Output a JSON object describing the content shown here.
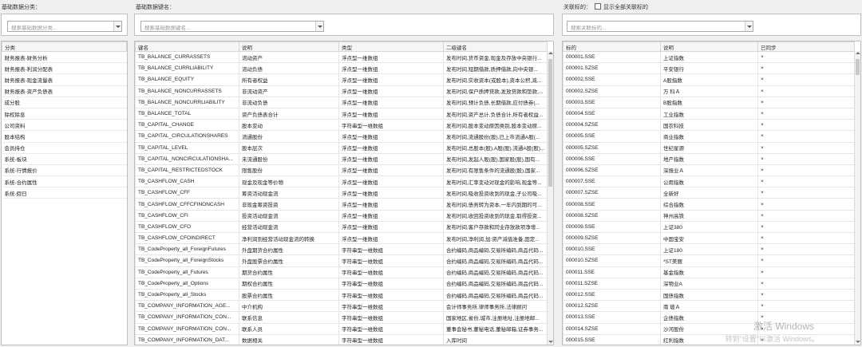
{
  "left_panel": {
    "label": "基础数据分类：",
    "search_placeholder": "搜索基础数据分类...",
    "column_header": "分类",
    "categories": [
      "财务报表-财务分析",
      "财务报表-利润分配表",
      "财务报表-现金流量表",
      "财务报表-资产负债表",
      "成分股",
      "除权除息",
      "公司资料",
      "股本结构",
      "会员持仓",
      "系统-板块",
      "系统-行情报价",
      "系统-合约属性",
      "系统-假日"
    ]
  },
  "middle_panel": {
    "label": "基础数据键名：",
    "search_placeholder": "搜索基础数据键名...",
    "columns": [
      "键名",
      "说明",
      "类型",
      "二级键名"
    ],
    "rows": [
      [
        "TB_BALANCE_CURRASSETS",
        "流动资产",
        "浮点型一维数组",
        "发布时间,货币资金,现金及存放中央银行..."
      ],
      [
        "TB_BALANCE_CURRLIABILITY",
        "流动负债",
        "浮点型一维数组",
        "发布时间,短期借款,质押借款,向中央银..."
      ],
      [
        "TB_BALANCE_EQUITY",
        "所有者权益",
        "浮点型一维数组",
        "发布时间,实收资本(或股本),资本公积,减..."
      ],
      [
        "TB_BALANCE_NONCURRASSETS",
        "非流动资产",
        "浮点型一维数组",
        "发布时间,保户质押贷款,发放贷款和垫款,..."
      ],
      [
        "TB_BALANCE_NONCURRLIABILITY",
        "非流动负债",
        "浮点型一维数组",
        "发布时间,预计负债,长期借款,应付债券(..."
      ],
      [
        "TB_BALANCE_TOTAL",
        "资产负债表合计",
        "浮点型一维数组",
        "发布时间,资产总计,负债合计,所有者权益..."
      ],
      [
        "TB_CAPITAL_CHANGE",
        "股本变动",
        "字符串型一维数组",
        "发布时间,股本变动原因类别,股本变动原..."
      ],
      [
        "TB_CAPITAL_CIRCULATIONSHARES",
        "流通股份",
        "浮点型一维数组",
        "发布时间,流通股份(股),已上市流通A股(..."
      ],
      [
        "TB_CAPITAL_LEVEL",
        "股本层次",
        "浮点型一维数组",
        "发布时间,总股本(股),A股(股),流通A股(股)..."
      ],
      [
        "TB_CAPITAL_NONCIRCULATIONSHA...",
        "未流通股份",
        "浮点型一维数组",
        "发布时间,发起人股(股),国家股(股),国有..."
      ],
      [
        "TB_CAPITAL_RESTRICTEDSTOCK",
        "限售股份",
        "浮点型一维数组",
        "发布时间,有限售条件的流通股(股),国家..."
      ],
      [
        "TB_CASHFLOW_CASH",
        "现金及现金等价物",
        "浮点型一维数组",
        "发布时间,汇率变动对现金的影响,现金等..."
      ],
      [
        "TB_CASHFLOW_CFF",
        "筹资活动现金流",
        "浮点型一维数组",
        "发布时间,吸收投资收到的现金,子公司吸..."
      ],
      [
        "TB_CASHFLOW_CFFCFINONCASH",
        "非现金筹资投资",
        "浮点型一维数组",
        "发布时间,债务转为资本,一年内到期的可..."
      ],
      [
        "TB_CASHFLOW_CFI",
        "投资活动现金流",
        "浮点型一维数组",
        "发布时间,收回投资收到的现金,取得投资..."
      ],
      [
        "TB_CASHFLOW_CFO",
        "经营活动现金流",
        "浮点型一维数组",
        "发布时间,客户存款和同业存放款项净增..."
      ],
      [
        "TB_CASHFLOW_CFOINDIRECT",
        "净利润到经营活动现金流的转换",
        "浮点型一维数组",
        "发布时间,净利润,加:资产减值准备,固定..."
      ],
      [
        "TB_CodeProperty_all_ForeignFutures",
        "外盘期货合约属性",
        "字符串型一维数组",
        "合约编码,商品编码,交易所编码,商品代码..."
      ],
      [
        "TB_CodeProperty_all_ForeignStocks",
        "外盘股票合约属性",
        "字符串型一维数组",
        "合约编码,商品编码,交易所编码,商品代码..."
      ],
      [
        "TB_CodeProperty_all_Futures",
        "期货合约属性",
        "字符串型一维数组",
        "合约编码,商品编码,交易所编码,商品代码..."
      ],
      [
        "TB_CodeProperty_all_Options",
        "期权合约属性",
        "字符串型一维数组",
        "合约编码,商品编码,交易所编码,商品代码..."
      ],
      [
        "TB_CodeProperty_all_Stocks",
        "股票合约属性",
        "字符串型一维数组",
        "合约编码,商品编码,交易所编码,商品代码..."
      ],
      [
        "TB_COMPANY_INFORMATION_AGE...",
        "中介机构",
        "字符串型一维数组",
        "会计师事务所,律师事务所,法律顾问"
      ],
      [
        "TB_COMPANY_INFORMATION_CON...",
        "联系信息",
        "字符串型一维数组",
        "国家地区,省份,城市,注册地址,注册地邮..."
      ],
      [
        "TB_COMPANY_INFORMATION_CON...",
        "联系人员",
        "字符串型一维数组",
        "董事会秘书,董秘电话,董秘邮箱,证券事务..."
      ],
      [
        "TB_COMPANY_INFORMATION_DAT...",
        "数据相关",
        "字符串型一维数组",
        "入库时间"
      ]
    ]
  },
  "right_panel": {
    "label": "关联标的：",
    "show_all_label": "显示全部关联标的",
    "search_placeholder": "搜索关联标的...",
    "columns": [
      "标的",
      "说明",
      "已同步"
    ],
    "rows": [
      [
        "000001.SSE",
        "上证指数",
        "×"
      ],
      [
        "000001.SZSE",
        "平安银行",
        "×"
      ],
      [
        "000002.SSE",
        "A股指数",
        "×"
      ],
      [
        "000002.SZSE",
        "万 科Ａ",
        "×"
      ],
      [
        "000003.SSE",
        "B股指数",
        "×"
      ],
      [
        "000004.SSE",
        "工业指数",
        "×"
      ],
      [
        "000004.SZSE",
        "国农科技",
        "×"
      ],
      [
        "000005.SSE",
        "商业指数",
        "×"
      ],
      [
        "000005.SZSE",
        "世纪星源",
        "×"
      ],
      [
        "000006.SSE",
        "地产指数",
        "×"
      ],
      [
        "000006.SZSE",
        "深振业Ａ",
        "×"
      ],
      [
        "000007.SSE",
        "公用指数",
        "×"
      ],
      [
        "000007.SZSE",
        "全新好",
        "×"
      ],
      [
        "000008.SSE",
        "综合指数",
        "×"
      ],
      [
        "000008.SZSE",
        "神州高铁",
        "×"
      ],
      [
        "000009.SSE",
        "上证380",
        "×"
      ],
      [
        "000009.SZSE",
        "中国宝安",
        "×"
      ],
      [
        "000010.SSE",
        "上证180",
        "×"
      ],
      [
        "000010.SZSE",
        "*ST美丽",
        "×"
      ],
      [
        "000011.SSE",
        "基金指数",
        "×"
      ],
      [
        "000011.SZSE",
        "深物业A",
        "×"
      ],
      [
        "000012.SSE",
        "国债指数",
        "×"
      ],
      [
        "000012.SZSE",
        "南 玻Ａ",
        "×"
      ],
      [
        "000013.SSE",
        "企债指数",
        "×"
      ],
      [
        "000014.SZSE",
        "沙河股份",
        "×"
      ],
      [
        "000015.SSE",
        "红利指数",
        "×"
      ]
    ]
  },
  "watermark": {
    "line1": "激活 Windows",
    "line2": "转到\"设置\"以激活 Windows。"
  }
}
